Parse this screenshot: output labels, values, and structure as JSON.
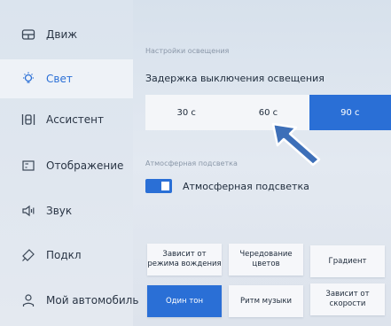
{
  "sidebar": {
    "items": [
      {
        "label": "Движ",
        "icon": "steering-wheel-icon"
      },
      {
        "label": "Свет",
        "icon": "light-bulb-icon",
        "active": true
      },
      {
        "label": "Ассистент",
        "icon": "assistant-icon"
      },
      {
        "label": "Отображение",
        "icon": "display-icon"
      },
      {
        "label": "Звук",
        "icon": "speaker-icon"
      },
      {
        "label": "Подкл",
        "icon": "link-icon"
      },
      {
        "label": "Мой автомобиль",
        "icon": "user-icon"
      }
    ]
  },
  "lighting": {
    "section_title": "Настройки освещения",
    "delay_heading": "Задержка выключения освещения",
    "delay_options": [
      "30 с",
      "60 с",
      "90 с"
    ],
    "delay_selected": "90 с"
  },
  "ambient": {
    "section_title": "Атмосферная подсветка",
    "toggle_label": "Атмосферная подсветка",
    "toggle_on": true,
    "modes": [
      "Зависит от режима вождения",
      "Чередование цветов",
      "Градиент",
      "Один тон",
      "Ритм музыки",
      "Зависит от скорости"
    ],
    "mode_selected": "Один тон"
  },
  "colors": {
    "accent": "#2a6fd6",
    "cursor": "#3d6fb8"
  }
}
